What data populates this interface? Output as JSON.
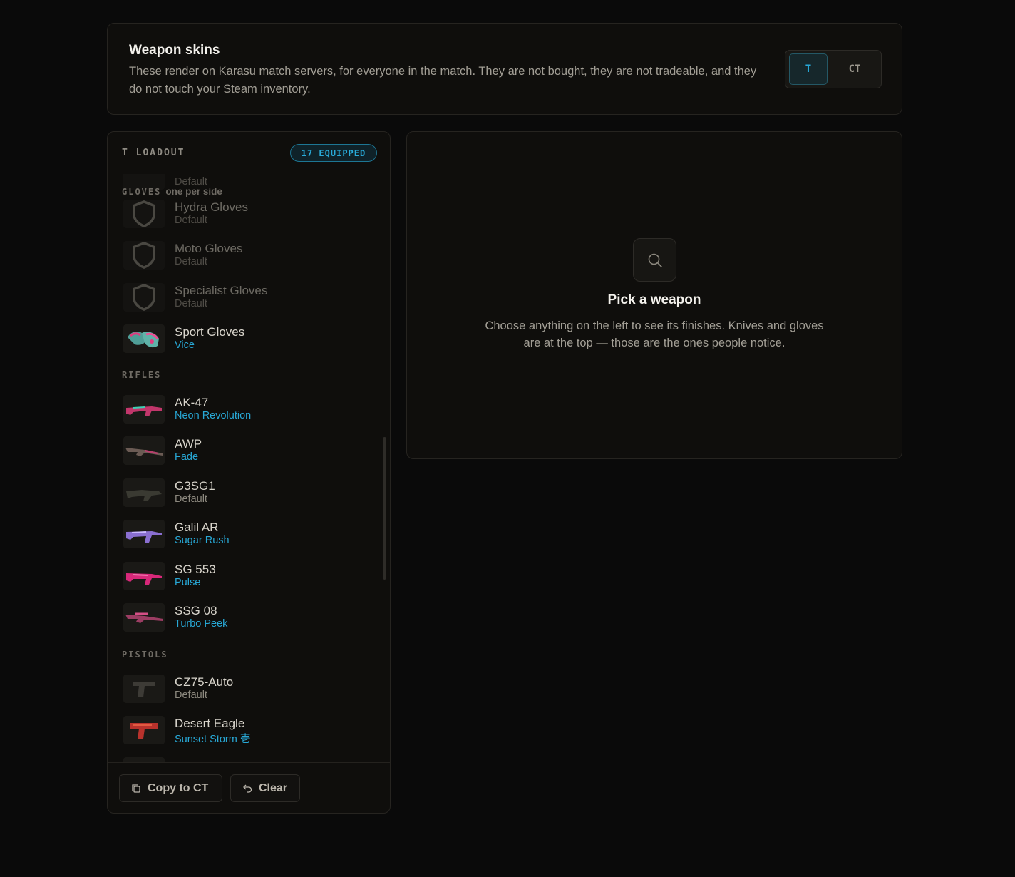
{
  "header": {
    "title": "Weapon skins",
    "description": "These render on Karasu match servers, for everyone in the match. They are not bought, they are not tradeable, and they do not touch your Steam inventory.",
    "side_t": "T",
    "side_ct": "CT",
    "active_side": "T"
  },
  "loadout": {
    "title": "T LOADOUT",
    "equipped_badge": "17 EQUIPPED",
    "partial_top_skin": "Default",
    "sections": {
      "gloves": {
        "label": "GLOVES",
        "note": "one per side"
      },
      "rifles": {
        "label": "RIFLES"
      },
      "pistols": {
        "label": "PISTOLS"
      }
    },
    "gloves": [
      {
        "name": "Hydra Gloves",
        "skin": "Default",
        "icon": "shield-icon"
      },
      {
        "name": "Moto Gloves",
        "skin": "Default",
        "icon": "shield-icon"
      },
      {
        "name": "Specialist Gloves",
        "skin": "Default",
        "icon": "shield-icon"
      },
      {
        "name": "Sport Gloves",
        "skin": "Vice",
        "icon": "gloves-thumbnail"
      }
    ],
    "rifles": [
      {
        "name": "AK-47",
        "skin": "Neon Revolution"
      },
      {
        "name": "AWP",
        "skin": "Fade"
      },
      {
        "name": "G3SG1",
        "skin": "Default"
      },
      {
        "name": "Galil AR",
        "skin": "Sugar Rush"
      },
      {
        "name": "SG 553",
        "skin": "Pulse"
      },
      {
        "name": "SSG 08",
        "skin": "Turbo Peek"
      }
    ],
    "pistols": [
      {
        "name": "CZ75-Auto",
        "skin": "Default"
      },
      {
        "name": "Desert Eagle",
        "skin": "Sunset Storm 壱"
      }
    ],
    "copy_button": "Copy to CT",
    "clear_button": "Clear"
  },
  "picker": {
    "title": "Pick a weapon",
    "description": "Choose anything on the left to see its finishes. Knives and gloves are at the top — those are the ones people notice."
  },
  "colors": {
    "accent": "#28a8d6",
    "background": "#0a0a0a",
    "panel": "#0f0e0c"
  }
}
